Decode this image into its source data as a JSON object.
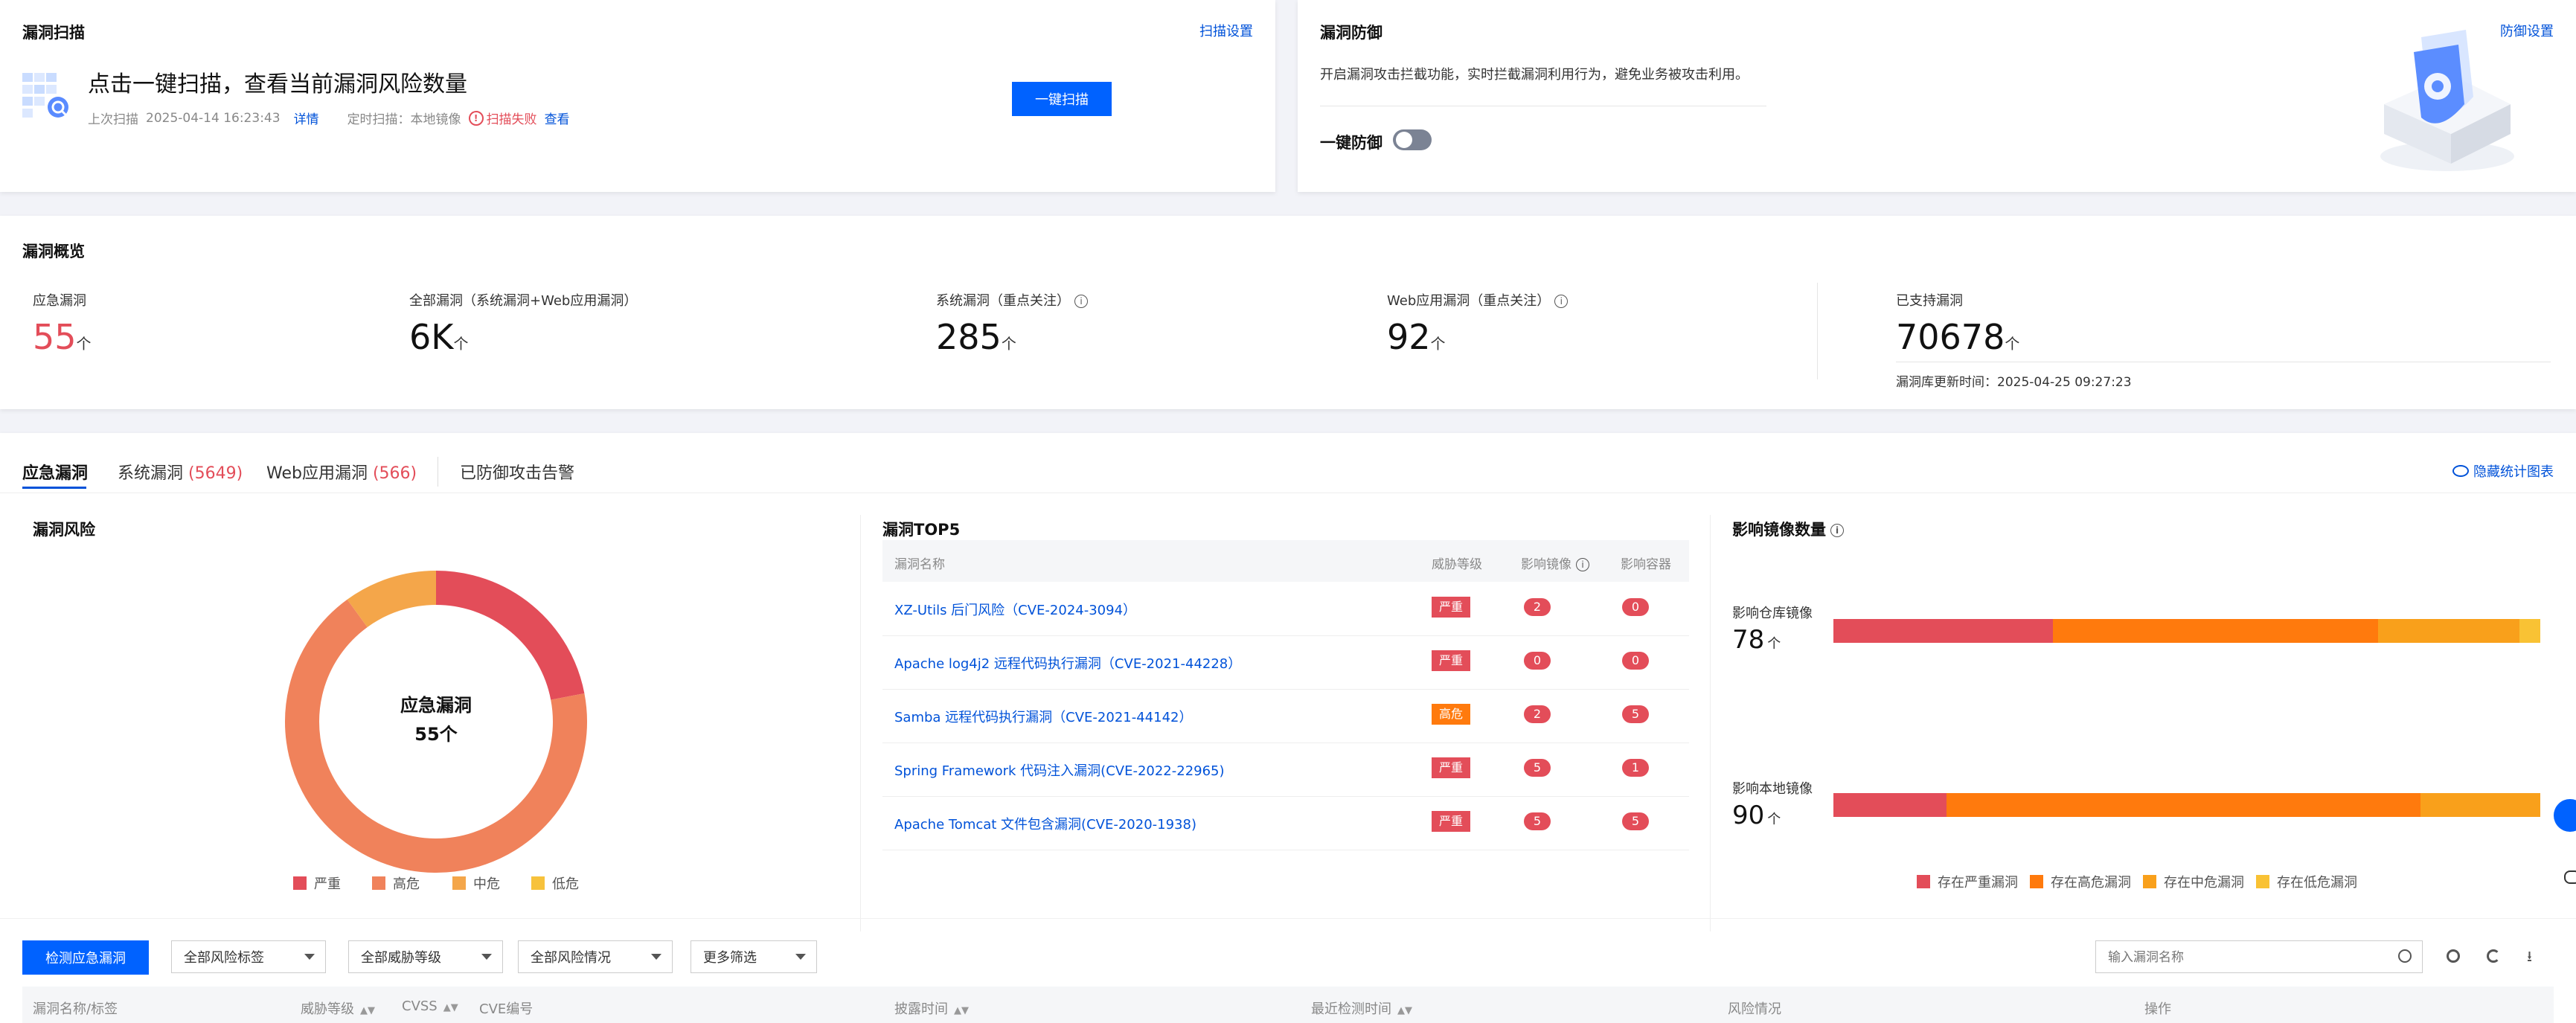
{
  "scan": {
    "title": "漏洞扫描",
    "settings": "扫描设置",
    "headline": "点击一键扫描，查看当前漏洞风险数量",
    "last_scan_label": "上次扫描",
    "last_scan_time": "2025-04-14 16:23:43",
    "detail": "详情",
    "scheduled_label": "定时扫描：本地镜像",
    "fail": "扫描失败",
    "view": "查看",
    "button": "一键扫描"
  },
  "defense": {
    "title": "漏洞防御",
    "settings": "防御设置",
    "desc": "开启漏洞攻击拦截功能，实时拦截漏洞利用行为，避免业务被攻击利用。",
    "toggle_label": "一键防御"
  },
  "overview": {
    "title": "漏洞概览",
    "stats": [
      {
        "label": "应急漏洞",
        "value": "55",
        "unit": "个"
      },
      {
        "label": "全部漏洞（系统漏洞+Web应用漏洞）",
        "value": "6K",
        "unit": "个"
      },
      {
        "label": "系统漏洞（重点关注）",
        "value": "285",
        "unit": "个"
      },
      {
        "label": "Web应用漏洞（重点关注）",
        "value": "92",
        "unit": "个"
      },
      {
        "label": "已支持漏洞",
        "value": "70678",
        "unit": "个"
      }
    ],
    "update_label": "漏洞库更新时间：2025-04-25 09:27:23"
  },
  "tabs": [
    {
      "label": "应急漏洞",
      "count": ""
    },
    {
      "label": "系统漏洞",
      "count": "(5649)"
    },
    {
      "label": "Web应用漏洞",
      "count": "(566)"
    },
    {
      "label": "已防御攻击告警",
      "count": ""
    }
  ],
  "hide_charts": "隐藏统计图表",
  "risk": {
    "title": "漏洞风险",
    "center_title": "应急漏洞",
    "center_value": "55个",
    "legend": [
      "严重",
      "高危",
      "中危",
      "低危"
    ]
  },
  "top5": {
    "title": "漏洞TOP5",
    "headers": [
      "漏洞名称",
      "威胁等级",
      "影响镜像",
      "影响容器"
    ],
    "rows": [
      {
        "name": "XZ-Utils 后门风险（CVE-2024-3094）",
        "level": "严重",
        "images": "2",
        "containers": "0"
      },
      {
        "name": "Apache log4j2 远程代码执行漏洞（CVE-2021-44228）",
        "level": "严重",
        "images": "0",
        "containers": "0"
      },
      {
        "name": "Samba 远程代码执行漏洞（CVE-2021-44142）",
        "level": "高危",
        "images": "2",
        "containers": "5"
      },
      {
        "name": "Spring Framework 代码注入漏洞(CVE-2022-22965)",
        "level": "严重",
        "images": "5",
        "containers": "1"
      },
      {
        "name": "Apache Tomcat 文件包含漏洞(CVE-2020-1938)",
        "level": "严重",
        "images": "5",
        "containers": "5"
      }
    ]
  },
  "impact": {
    "title": "影响镜像数量",
    "rows": [
      {
        "label": "影响仓库镜像",
        "value": "78",
        "unit": "个"
      },
      {
        "label": "影响本地镜像",
        "value": "90",
        "unit": "个"
      }
    ],
    "legend": [
      "存在严重漏洞",
      "存在高危漏洞",
      "存在中危漏洞",
      "存在低危漏洞"
    ]
  },
  "chart_data": [
    {
      "type": "pie",
      "title": "漏洞风险",
      "categories": [
        "严重",
        "高危",
        "中危",
        "低危"
      ],
      "values": [
        0.22,
        0.68,
        0.1,
        0.0
      ],
      "colors": [
        "#e34d59",
        "#f0825b",
        "#f4a64a",
        "#f7c23c"
      ]
    },
    {
      "type": "bar",
      "title": "影响镜像数量",
      "categories": [
        "影响仓库镜像",
        "影响本地镜像"
      ],
      "series": [
        {
          "name": "存在严重漏洞",
          "values": [
            0.31,
            0.16
          ]
        },
        {
          "name": "存在高危漏洞",
          "values": [
            0.46,
            0.67
          ]
        },
        {
          "name": "存在中危漏洞",
          "values": [
            0.2,
            0.17
          ]
        },
        {
          "name": "存在低危漏洞",
          "values": [
            0.03,
            0.0
          ]
        }
      ],
      "colors": [
        "#e34d59",
        "#ff7a0d",
        "#f9a01b",
        "#f9c234"
      ]
    }
  ],
  "toolbar": {
    "detect_button": "检测应急漏洞",
    "filters": [
      "全部风险标签",
      "全部威胁等级",
      "全部风险情况",
      "更多筛选"
    ],
    "search_placeholder": "输入漏洞名称"
  },
  "table": {
    "columns": [
      "漏洞名称/标签",
      "威胁等级",
      "CVSS",
      "CVE编号",
      "披露时间",
      "最近检测时间",
      "风险情况",
      "操作"
    ]
  },
  "colors": {
    "primary": "#0062ff",
    "link": "#0052d9",
    "danger": "#e34d59",
    "high": "#ff7a0d"
  }
}
